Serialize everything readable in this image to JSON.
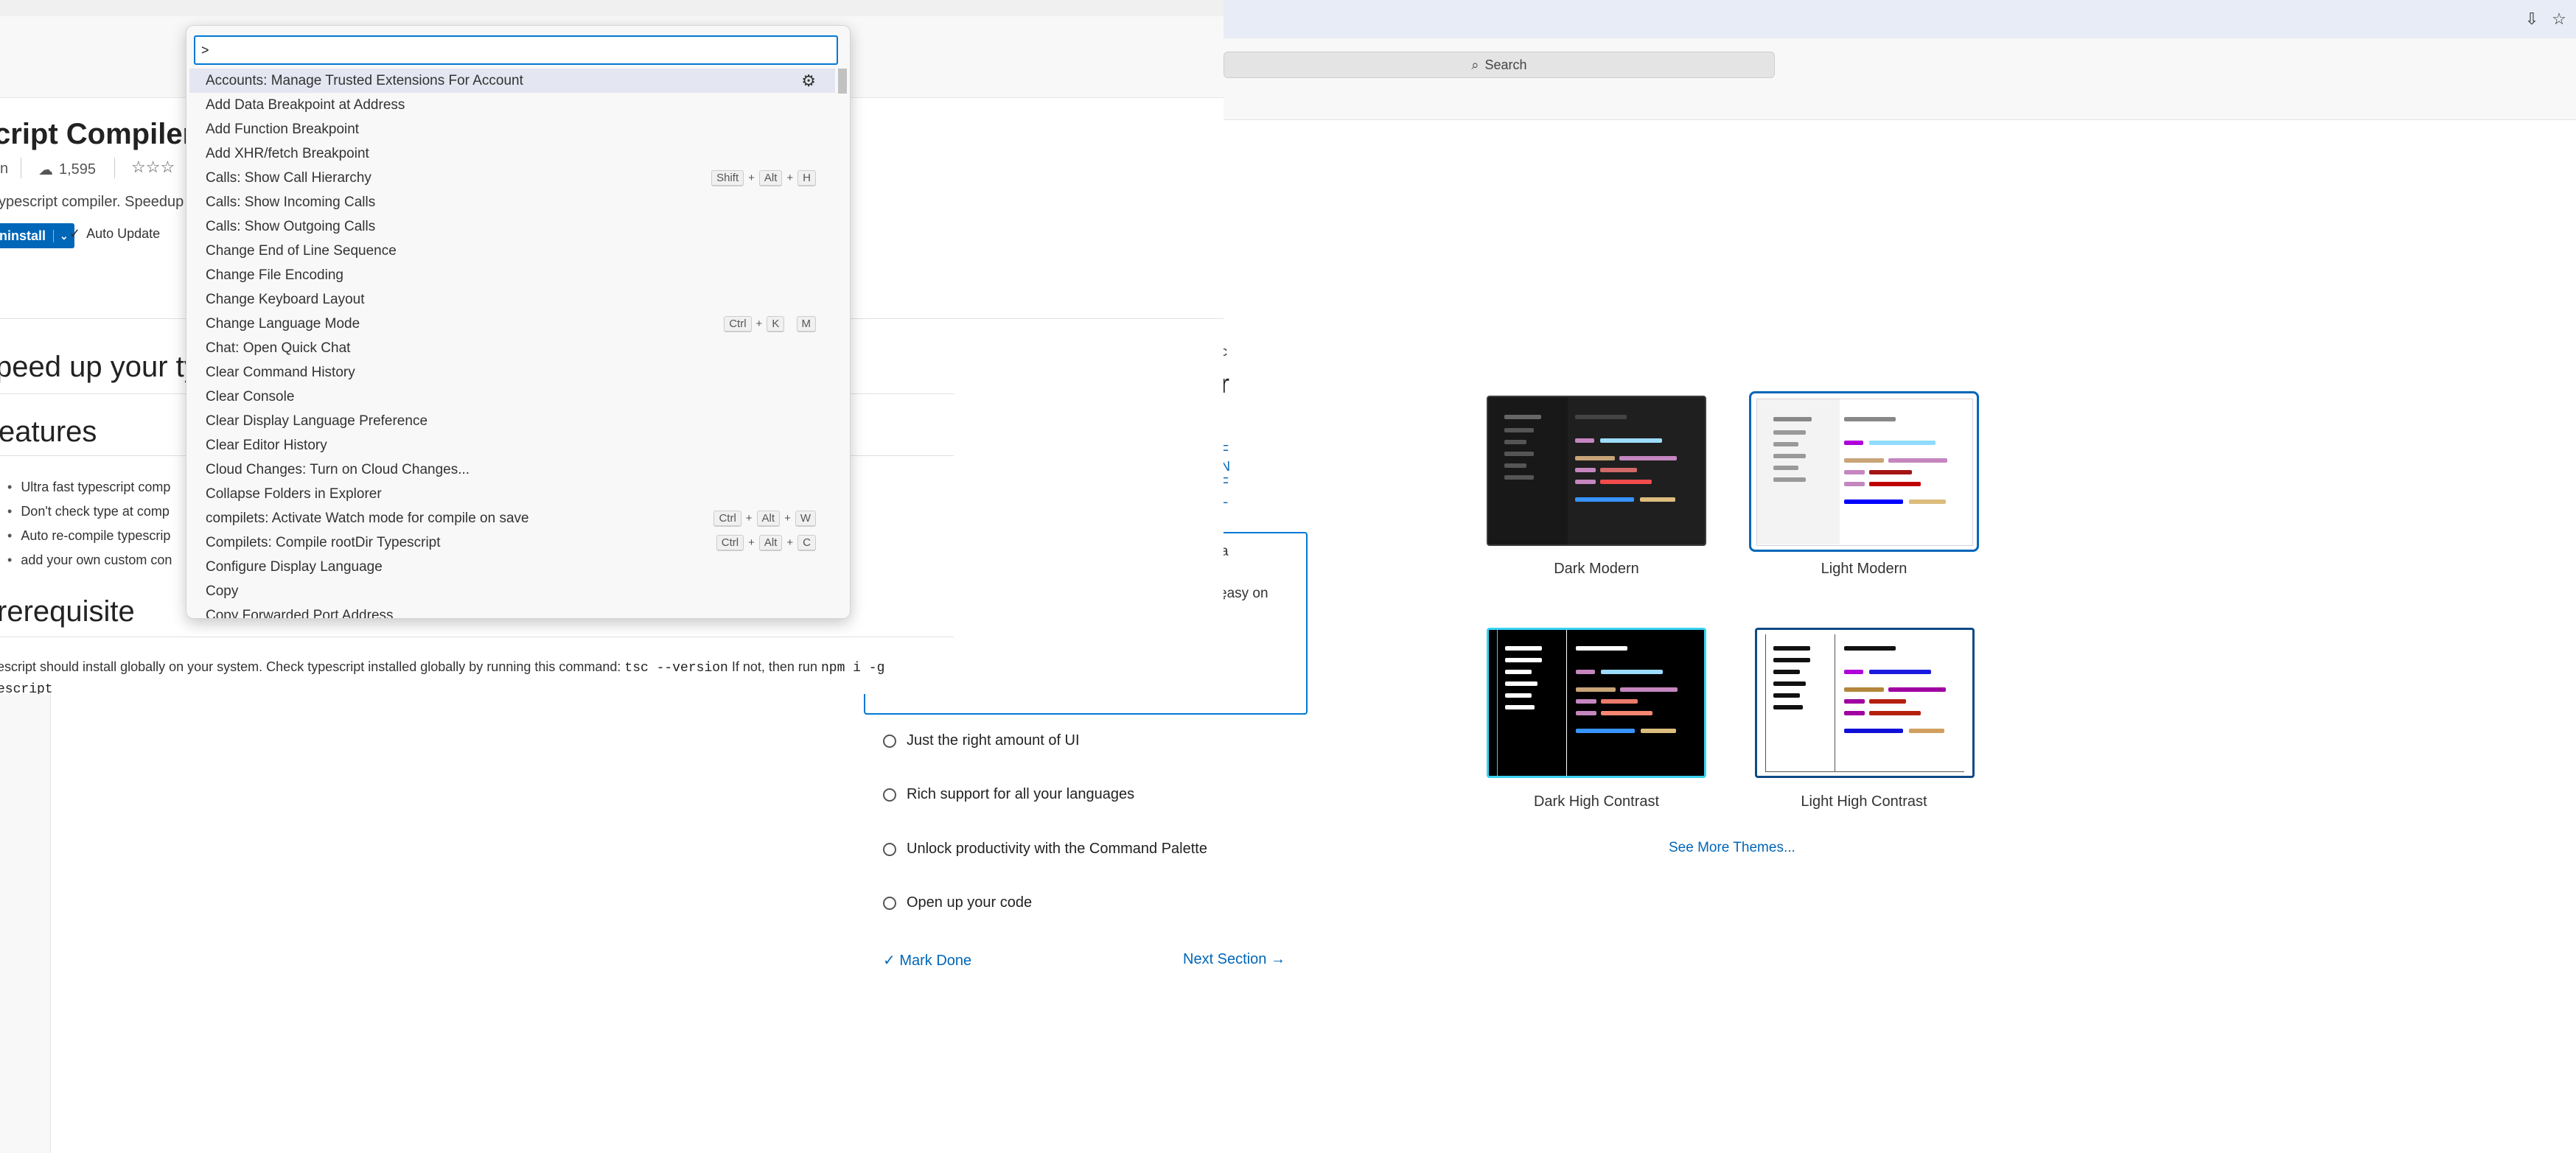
{
  "search": {
    "label": "Search"
  },
  "extension": {
    "title": "cript Compiler",
    "publisher_fragment": "n",
    "install_count": "1,595",
    "rating": "☆☆☆",
    "description": "ypescript compiler. Speedup",
    "uninstall_label": "Uninstall",
    "auto_update_label": "Auto Update"
  },
  "readme": {
    "heading1": "peed up your ty",
    "heading2": "eatures",
    "bullets": [
      "Ultra fast typescript comp",
      "Don't check type at comp",
      "Auto re-compile typescrip",
      "add your own custom con"
    ],
    "heading3": "rerequisite",
    "prereq_text": "escript should install globally on your system. Check typescript installed globally by running this command:",
    "prereq_code1": "tsc --version",
    "prereq_text2": "If not, then run",
    "prereq_code2": "npm i -g",
    "prereq_tail": "escript"
  },
  "palette": {
    "input_value": ">",
    "items": [
      {
        "label": "Accounts: Manage Trusted Extensions For Account",
        "keys": [],
        "gear": true
      },
      {
        "label": "Add Data Breakpoint at Address",
        "keys": []
      },
      {
        "label": "Add Function Breakpoint",
        "keys": []
      },
      {
        "label": "Add XHR/fetch Breakpoint",
        "keys": []
      },
      {
        "label": "Calls: Show Call Hierarchy",
        "keys": [
          "Shift",
          "+",
          "Alt",
          "+",
          "H"
        ]
      },
      {
        "label": "Calls: Show Incoming Calls",
        "keys": []
      },
      {
        "label": "Calls: Show Outgoing Calls",
        "keys": []
      },
      {
        "label": "Change End of Line Sequence",
        "keys": []
      },
      {
        "label": "Change File Encoding",
        "keys": []
      },
      {
        "label": "Change Keyboard Layout",
        "keys": []
      },
      {
        "label": "Change Language Mode",
        "keys": [
          "Ctrl",
          "+",
          "K",
          " ",
          "M"
        ]
      },
      {
        "label": "Chat: Open Quick Chat",
        "keys": []
      },
      {
        "label": "Clear Command History",
        "keys": []
      },
      {
        "label": "Clear Console",
        "keys": []
      },
      {
        "label": "Clear Display Language Preference",
        "keys": []
      },
      {
        "label": "Clear Editor History",
        "keys": []
      },
      {
        "label": "Cloud Changes: Turn on Cloud Changes...",
        "keys": []
      },
      {
        "label": "Collapse Folders in Explorer",
        "keys": []
      },
      {
        "label": "compilets: Activate Watch mode for compile on save",
        "keys": [
          "Ctrl",
          "+",
          "Alt",
          "+",
          "W"
        ]
      },
      {
        "label": "Compilets: Compile rootDir Typescript",
        "keys": [
          "Ctrl",
          "+",
          "Alt",
          "+",
          "C"
        ]
      },
      {
        "label": "Configure Display Language",
        "keys": []
      },
      {
        "label": "Copy",
        "keys": []
      },
      {
        "label": "Copy Forwarded Port Address",
        "keys": []
      }
    ]
  },
  "walkthrough": {
    "partial_text": "easy on",
    "steps": [
      "Just the right amount of UI",
      "Rich support for all your languages",
      "Unlock productivity with the Command Palette",
      "Open up your code"
    ],
    "mark_done": "Mark Done",
    "next_section": "Next Section"
  },
  "themes": {
    "items": [
      {
        "name": "Dark Modern"
      },
      {
        "name": "Light Modern"
      },
      {
        "name": "Dark High Contrast"
      },
      {
        "name": "Light High Contrast"
      }
    ],
    "see_more": "See More Themes..."
  },
  "colors": {
    "accent": "#0078d4",
    "link": "#0066b8",
    "selected_row": "#e4e6f1"
  }
}
